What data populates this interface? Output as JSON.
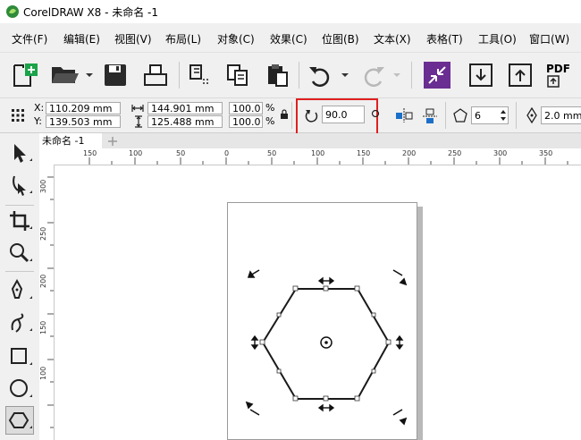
{
  "window": {
    "title": "CorelDRAW X8 - 未命名 -1"
  },
  "menu": [
    {
      "label": "文件(F)"
    },
    {
      "label": "编辑(E)"
    },
    {
      "label": "视图(V)"
    },
    {
      "label": "布局(L)"
    },
    {
      "label": "对象(C)"
    },
    {
      "label": "效果(C)"
    },
    {
      "label": "位图(B)"
    },
    {
      "label": "文本(X)"
    },
    {
      "label": "表格(T)"
    },
    {
      "label": "工具(O)"
    },
    {
      "label": "窗口(W)"
    }
  ],
  "toolbar": {
    "pdf_label": "PDF"
  },
  "props": {
    "x_label": "X:",
    "x_value": "110.209 mm",
    "y_label": "Y:",
    "y_value": "139.503 mm",
    "w_value": "144.901 mm",
    "h_value": "125.488 mm",
    "scale_w": "100.0",
    "scale_h": "100.0",
    "percent": "%",
    "rotation": "90.0",
    "sides": "6",
    "outline": "2.0 mm"
  },
  "document": {
    "tab_label": "未命名 -1"
  },
  "ruler": {
    "h_ticks": [
      "150",
      "100",
      "50",
      "0",
      "50",
      "100",
      "150",
      "200",
      "250",
      "300",
      "350"
    ],
    "v_ticks": [
      "300",
      "250",
      "200",
      "150",
      "100"
    ]
  },
  "colors": {
    "highlight": "#e02020",
    "accent": "#6a2d91"
  }
}
